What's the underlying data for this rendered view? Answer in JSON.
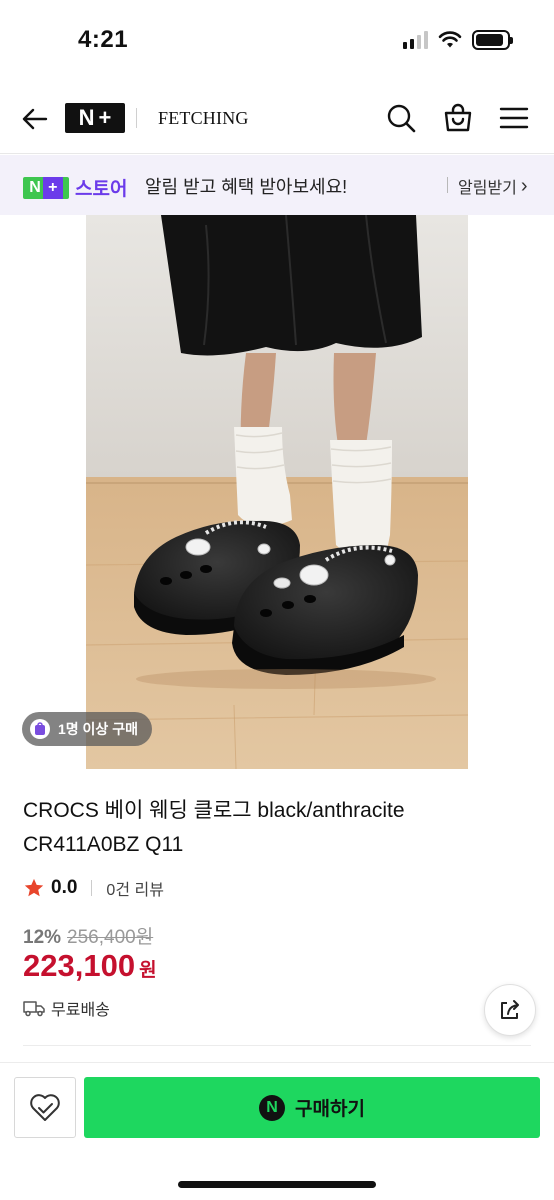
{
  "status_bar": {
    "time": "4:21",
    "battery_level": 0.9
  },
  "header": {
    "logo_n": "N",
    "logo_plus": "+",
    "brand_name": "FETCHING"
  },
  "banner": {
    "store_n": "N",
    "store_plus": "+",
    "store_label": "스토어",
    "message": "알림 받고 혜택 받아보세요!",
    "action_label": "알림받기",
    "action_chevron": "›"
  },
  "product": {
    "badge_text": "1명 이상 구매",
    "title": "CROCS 베이 웨딩 클로그 black/anthracite CR411A0BZ Q11",
    "rating": "0.0",
    "review_count": "0건 리뷰",
    "discount": "12%",
    "original_price": "256,400원",
    "sale_price": "223,100",
    "sale_unit": "원",
    "shipping": "무료배송"
  },
  "bottom_bar": {
    "buy_icon_text": "N",
    "buy_label": "구매하기"
  },
  "colors": {
    "accent_green": "#1ed75f",
    "price_red": "#c5102e",
    "store_purple": "#6b3bea",
    "star_red": "#e8452c"
  }
}
